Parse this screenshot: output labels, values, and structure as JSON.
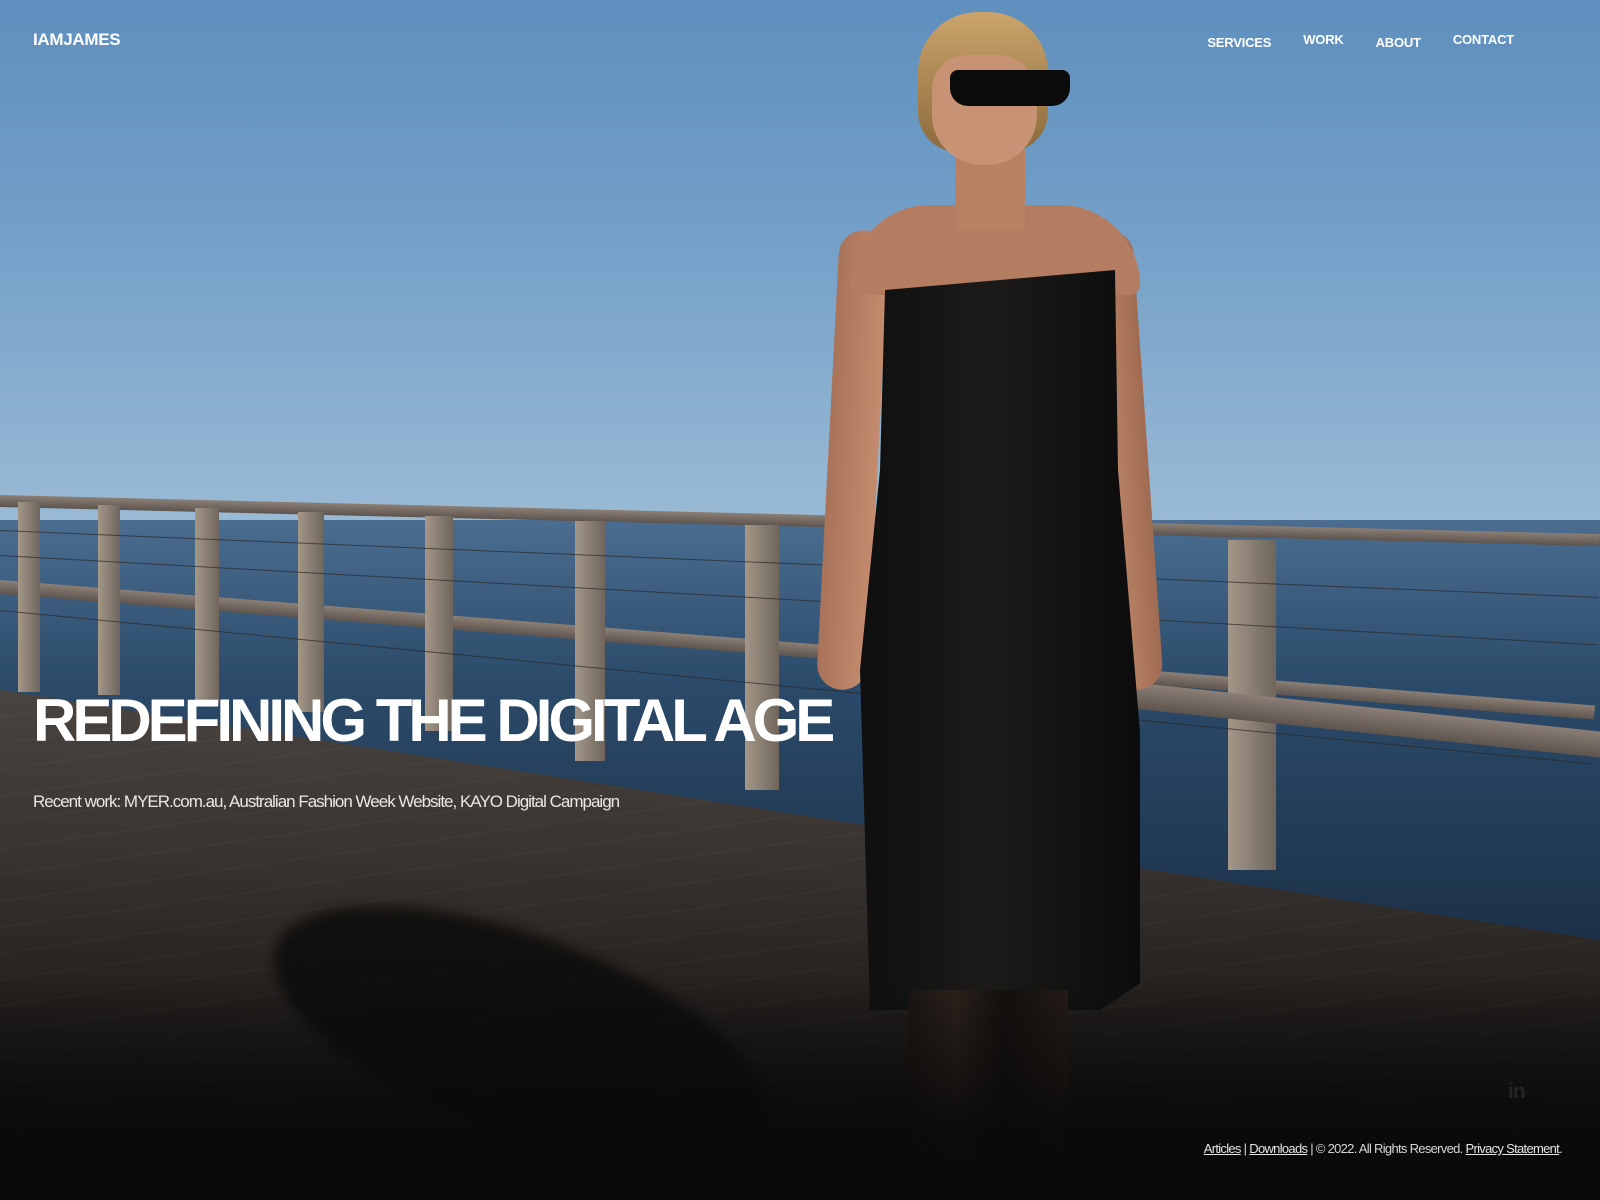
{
  "header": {
    "brand": "IAMJAMES",
    "nav": [
      "SERVICES",
      "WORK",
      "ABOUT",
      "CONTACT"
    ]
  },
  "hero": {
    "headline": "REDEFINING THE DIGITAL AGE",
    "recent_work": "Recent work: MYER.com.au, Australian Fashion Week Website, KAYO Digital Campaign"
  },
  "social": {
    "linkedin_label": "in",
    "icon": "linkedin-icon"
  },
  "footer": {
    "articles": "Articles",
    "sep1": " | ",
    "downloads": "Downloads",
    "copyright": " | © 2022. All Rights Reserved. ",
    "privacy": "Privacy Statement",
    "end": "."
  },
  "colors": {
    "text": "#ffffff",
    "sky": "#74a0c8",
    "background": "#0a0a0a"
  }
}
